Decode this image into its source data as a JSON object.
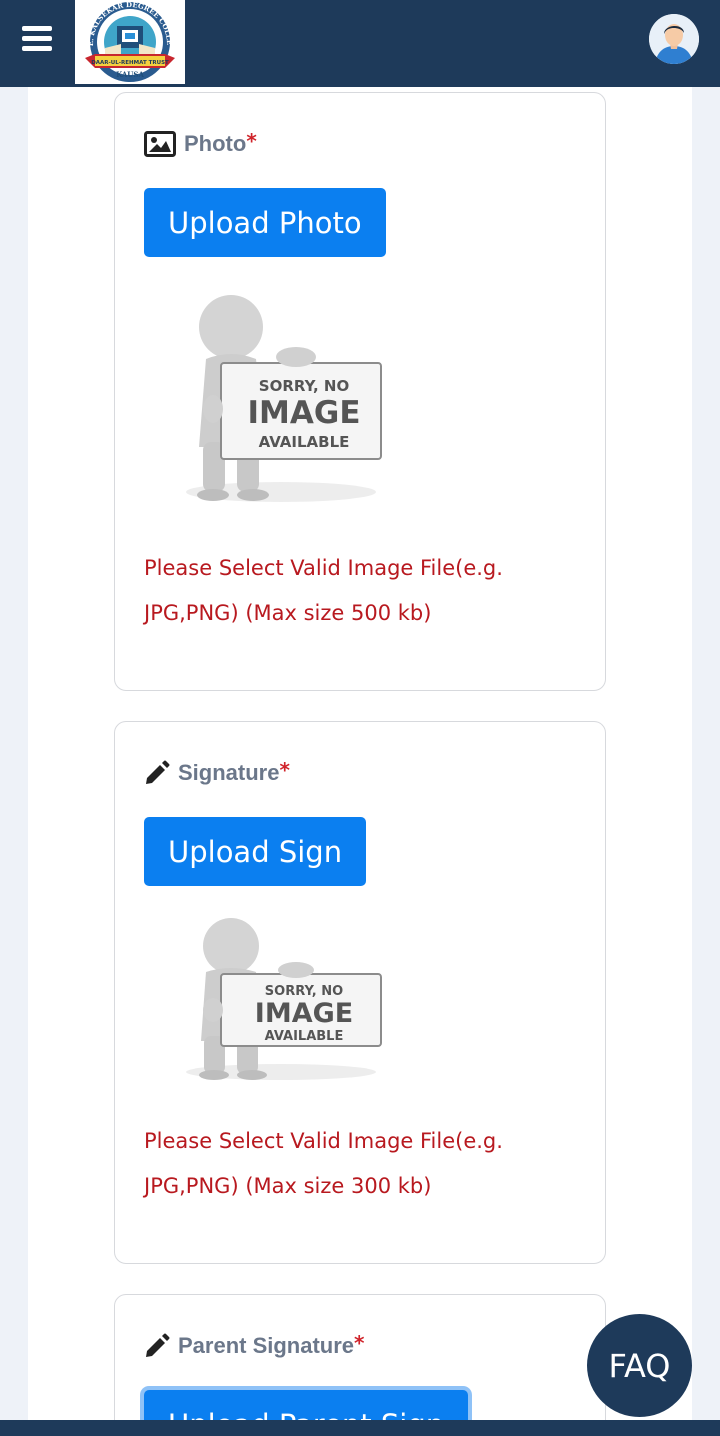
{
  "header": {
    "menu_icon": "hamburger-menu-icon",
    "logo": {
      "arc_text": "A. E. KALSEKAR DEGREE COLLEGE",
      "ribbon_text": "DAAR-UL-REHMAT TRUST",
      "bottom_text": "KAUSA"
    },
    "avatar_icon": "user-avatar-icon"
  },
  "sections": [
    {
      "icon": "image-icon",
      "title": "Photo",
      "required_mark": "*",
      "upload_label": "Upload Photo",
      "placeholder": {
        "line1": "SORRY, NO",
        "line2": "IMAGE",
        "line3": "AVAILABLE"
      },
      "hint": "Please Select Valid Image File(e.g. JPG,PNG) (Max size 500 kb)"
    },
    {
      "icon": "pencil-icon",
      "title": "Signature",
      "required_mark": "*",
      "upload_label": "Upload Sign",
      "placeholder": {
        "line1": "SORRY, NO",
        "line2": "IMAGE",
        "line3": "AVAILABLE"
      },
      "hint": "Please Select Valid Image File(e.g. JPG,PNG) (Max size 300 kb)"
    },
    {
      "icon": "pencil-icon",
      "title": "Parent Signature",
      "required_mark": "*",
      "upload_label": "Upload Parent Sign"
    }
  ],
  "faq": {
    "label": "FAQ"
  },
  "colors": {
    "navbar": "#1e3a5a",
    "button": "#0b7ff0",
    "hint_text": "#b8191f",
    "title_text": "#6b778a",
    "required": "#d0242b"
  }
}
